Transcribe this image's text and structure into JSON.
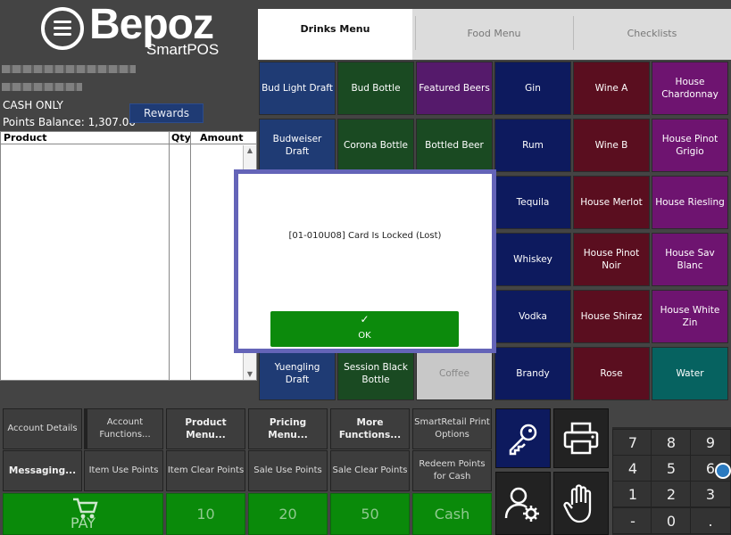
{
  "app": {
    "logo_word": "Bepoz",
    "logo_sub": "SmartPOS"
  },
  "customer": {
    "cash_only": "CASH ONLY",
    "points_balance": "Points Balance: 1,307.00",
    "rewards_label": "Rewards"
  },
  "order_table": {
    "headers": [
      "Product",
      "Qty",
      "Amount"
    ]
  },
  "tabs": [
    {
      "label": "Drinks Menu",
      "active": true
    },
    {
      "label": "Food Menu",
      "active": false
    },
    {
      "label": "Checklists",
      "active": false
    }
  ],
  "products": [
    [
      "Bud Light Draft",
      "Bud Bottle",
      "Featured Beers",
      "Gin",
      "Wine A",
      "House Chardonnay"
    ],
    [
      "Budweiser Draft",
      "Corona Bottle",
      "Bottled Beer",
      "Rum",
      "Wine B",
      "House Pinot Grigio"
    ],
    [
      "",
      "",
      "",
      "Tequila",
      "House Merlot",
      "House Riesling"
    ],
    [
      "",
      "",
      "",
      "Whiskey",
      "House Pinot Noir",
      "House Sav Blanc"
    ],
    [
      "",
      "",
      "",
      "Vodka",
      "House Shiraz",
      "House White Zin"
    ],
    [
      "Yuengling Draft",
      "Session Black Bottle",
      "Coffee",
      "Brandy",
      "Rose",
      "Water"
    ]
  ],
  "dialog": {
    "message": "[01-010U08] Card Is Locked (Lost)",
    "ok_check": "✓",
    "ok_label": "OK"
  },
  "functions": {
    "row1": [
      "Account Details",
      "Account Functions...",
      "Product Menu...",
      "Pricing Menu...",
      "More Functions...",
      "SmartRetail Print Options"
    ],
    "row2": [
      "Messaging...",
      "Item Use Points",
      "Item Clear Points",
      "Sale Use Points",
      "Sale Clear Points",
      "Redeem Points for Cash"
    ],
    "row3": [
      "PAY",
      "10",
      "20",
      "50",
      "Cash"
    ]
  },
  "numpad": [
    "7",
    "8",
    "9",
    "4",
    "5",
    "6",
    "1",
    "2",
    "3",
    "-",
    "0",
    "."
  ],
  "icons": {
    "key": "key-icon",
    "printer": "printer-icon",
    "user_settings": "user-settings-icon",
    "hand": "hand-icon",
    "cart": "cart-icon"
  }
}
